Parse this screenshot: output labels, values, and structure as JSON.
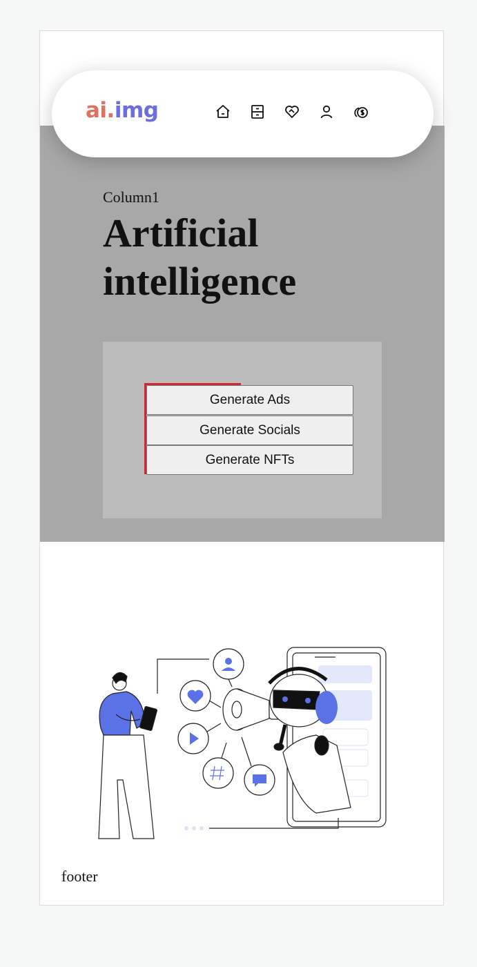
{
  "brand": {
    "logo_ai": "ai.",
    "logo_img": "img"
  },
  "nav": {
    "icons": [
      "home-icon",
      "archive-icon",
      "heart-handshake-icon",
      "user-icon",
      "coins-icon"
    ]
  },
  "hero": {
    "column_label": "Column1",
    "headline": "Artificial intelligence"
  },
  "actions": {
    "generate_ads": "Generate Ads",
    "generate_socials": "Generate Socials",
    "generate_nfts": "Generate NFTs"
  },
  "footer": {
    "text": "footer"
  },
  "colors": {
    "accent_blue": "#5b72e6",
    "logo_ai": "#e07060",
    "logo_img": "#6a6ee0",
    "highlight_red": "#d9232e"
  }
}
